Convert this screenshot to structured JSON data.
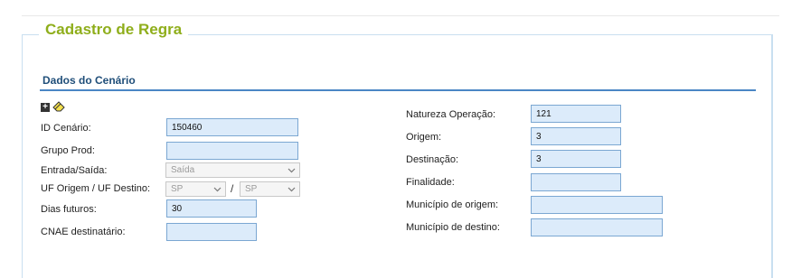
{
  "legend": "Cadastro de Regra",
  "section_title": "Dados do Cenário",
  "left": {
    "id_cenario": {
      "label": "ID Cenário:",
      "value": "150460"
    },
    "grupo_prod": {
      "label": "Grupo Prod:",
      "value": ""
    },
    "entrada_saida": {
      "label": "Entrada/Saída:",
      "value": "Saída"
    },
    "uf": {
      "label": "UF Origem / UF Destino:",
      "origem": "SP",
      "destino": "SP",
      "separator": "/"
    },
    "dias_futuros": {
      "label": "Dias futuros:",
      "value": "30"
    },
    "cnae": {
      "label": "CNAE destinatário:",
      "value": ""
    }
  },
  "right": {
    "natureza": {
      "label": "Natureza Operação:",
      "value": "121"
    },
    "origem": {
      "label": "Origem:",
      "value": "3"
    },
    "destinacao": {
      "label": "Destinação:",
      "value": "3"
    },
    "finalidade": {
      "label": "Finalidade:",
      "value": ""
    },
    "mun_origem": {
      "label": "Município de origem:",
      "value": ""
    },
    "mun_destino": {
      "label": "Município de destino:",
      "value": ""
    }
  },
  "colors": {
    "legend": "#8fae1b",
    "section": "#1f4e79",
    "input_bg": "#dcebfa",
    "input_border": "#7ba7d2"
  },
  "icons": [
    "plus-icon",
    "eraser-icon",
    "chevron-down-icon"
  ]
}
